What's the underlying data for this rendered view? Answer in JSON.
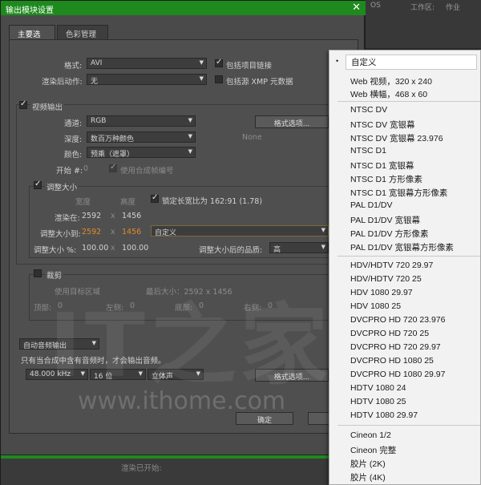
{
  "window": {
    "title": "输出模块设置",
    "close_glyph": "✕"
  },
  "background": {
    "item1": "OS",
    "item2": "工作区:",
    "item3": "作业"
  },
  "tabs": [
    "主要选项",
    "色彩管理"
  ],
  "main": {
    "format_label": "格式:",
    "format_value": "AVI",
    "include_project_link": "包括项目链接",
    "post_render_label": "渲染后动作:",
    "post_render_value": "无",
    "include_xmp": "包括源 XMP 元数据"
  },
  "video": {
    "section_label": "视频输出",
    "channels_label": "通道:",
    "channels_value": "RGB",
    "depth_label": "深度:",
    "depth_value": "数百万种颜色",
    "color_label": "颜色:",
    "color_value": "预乘（遮罩）",
    "start_label": "开始 #:",
    "start_value": "0",
    "use_comp_frame": "使用合成帧编号",
    "format_options_button": "格式选项...",
    "codec_value": "None"
  },
  "resize": {
    "section_label": "调整大小",
    "width_header": "宽度",
    "height_header": "高度",
    "lock_aspect": "锁定长宽比为 162:91 (1.78)",
    "render_at_label": "渲染在:",
    "render_w": "2592",
    "x1": "x",
    "render_h": "1456",
    "resize_to_label": "调整大小到:",
    "resize_w": "2592",
    "x2": "x",
    "resize_h": "1456",
    "preset_value": "自定义",
    "pct_label": "调整大小 %:",
    "pct_w": "100.00",
    "x3": "x",
    "pct_h": "100.00",
    "quality_label": "调整大小后的品质:",
    "quality_value": "高"
  },
  "crop": {
    "section_label": "裁剪",
    "use_roi": "使用目标区域",
    "final_size": "最后大小：2592 x 1456",
    "top_label": "顶部:",
    "top_value": "0",
    "left_label": "左侧:",
    "left_value": "0",
    "bottom_label": "底部:",
    "bottom_value": "0",
    "right_label": "右侧:",
    "right_value": "0"
  },
  "audio": {
    "mode_value": "自动音频输出",
    "note": "只有当合成中含有音频时，才会输出音频。",
    "rate_value": "48.000 kHz",
    "bits_value": "16 位",
    "channels_value": "立体声",
    "format_options_button": "格式选项..."
  },
  "footer": {
    "ok_button": "确定",
    "cancel_button": "取消",
    "status_text": "渲染已开始:"
  },
  "watermark": {
    "logo": "IT之家",
    "url": "www.ithome.com"
  },
  "menu": {
    "bullet": "•",
    "groups": [
      [
        "自定义",
        "Web 视频，320 x 240",
        "Web 横幅，468 x 60"
      ],
      [
        "NTSC DV",
        "NTSC DV 宽银幕",
        "NTSC DV 宽银幕 23.976",
        "NTSC D1",
        "NTSC D1 宽银幕",
        "NTSC D1 方形像素",
        "NTSC D1 宽银幕方形像素",
        "PAL D1/DV",
        "PAL D1/DV 宽银幕",
        "PAL D1/DV 方形像素",
        "PAL D1/DV 宽银幕方形像素"
      ],
      [
        "HDV/HDTV 720 29.97",
        "HDV/HDTV 720 25",
        "HDV 1080 29.97",
        "HDV 1080 25",
        "DVCPRO HD 720 23.976",
        "DVCPRO HD 720 25",
        "DVCPRO HD 720 29.97",
        "DVCPRO HD 1080 25",
        "DVCPRO HD 1080 29.97",
        "HDTV 1080 24",
        "HDTV 1080 25",
        "HDTV 1080 29.97"
      ],
      [
        "Cineon 1/2",
        "Cineon 完整",
        "胶片 (2K)",
        "胶片 (4K)"
      ]
    ]
  },
  "colors": {
    "title_green": "#1e8a1e",
    "accent_orange": "#e08a2a"
  }
}
